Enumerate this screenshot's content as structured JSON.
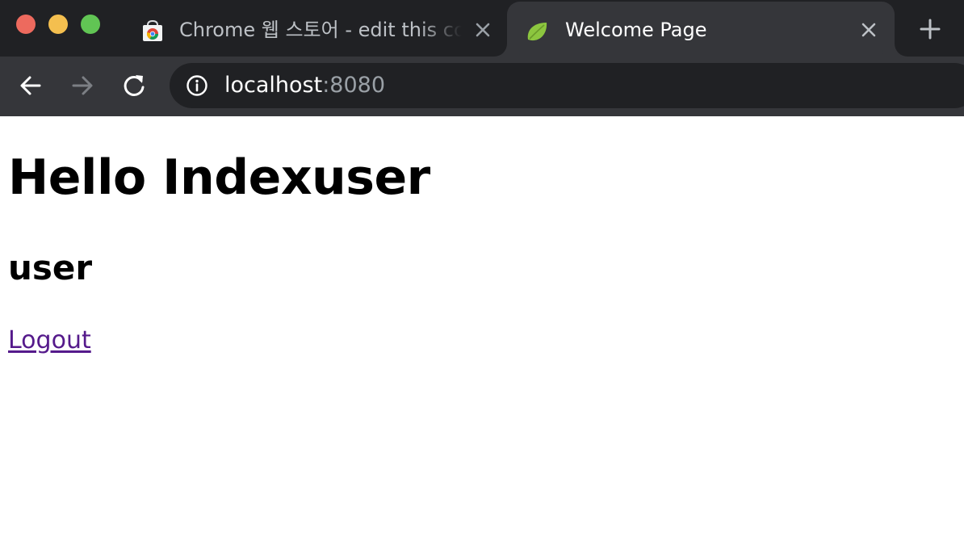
{
  "browser": {
    "tabs": [
      {
        "title": "Chrome 웹 스토어 - edit this cookie",
        "favicon": "chrome-web-store-icon",
        "active": false
      },
      {
        "title": "Welcome Page",
        "favicon": "spring-leaf-icon",
        "active": true
      }
    ],
    "address": {
      "host": "localhost",
      "port": ":8080"
    }
  },
  "page": {
    "heading": "Hello Indexuser",
    "subheading": "user",
    "logout_link": "Logout"
  },
  "colors": {
    "tabstrip": "#202124",
    "toolbar": "#35363a",
    "link_visited": "#551a8b"
  }
}
